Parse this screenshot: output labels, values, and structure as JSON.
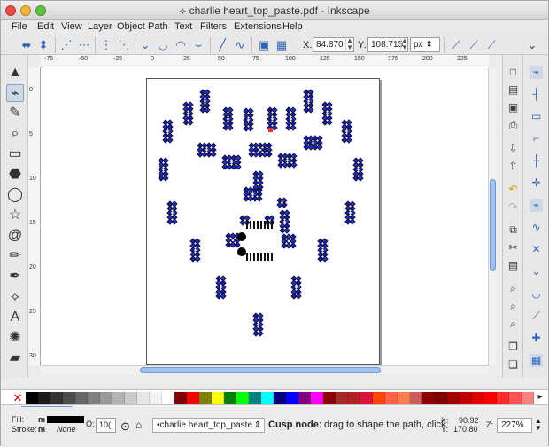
{
  "window": {
    "title": "charlie heart_top_paste.pdf - Inkscape",
    "buttons": [
      "close",
      "minimize",
      "zoom"
    ]
  },
  "menus": [
    "File",
    "Edit",
    "View",
    "Layer",
    "Object",
    "Path",
    "Text",
    "Filters",
    "Extensions",
    "Help"
  ],
  "toolbar": {
    "x_label": "X:",
    "x_value": "84.870",
    "y_label": "Y:",
    "y_value": "108.715",
    "unit": "px",
    "icons": [
      "insert-node-icon",
      "delete-node-icon",
      "join-nodes-icon",
      "break-path-icon",
      "join-segment-icon",
      "delete-segment-icon",
      "cusp-node-icon",
      "smooth-node-icon",
      "symmetric-node-icon",
      "auto-node-icon",
      "line-segment-icon",
      "curve-segment-icon",
      "object-to-path-icon",
      "stroke-to-path-icon",
      "next-path-effect-icon",
      "show-handles-icon",
      "show-outline-icon"
    ]
  },
  "rulers": {
    "top": [
      "-75",
      "-50",
      "-25",
      "0",
      "25",
      "50",
      "75",
      "100",
      "125",
      "150",
      "175",
      "200",
      "225"
    ],
    "left": [
      "0",
      "5",
      "10",
      "15",
      "20",
      "25",
      "30"
    ]
  },
  "tools": [
    {
      "name": "selector-tool-icon",
      "glyph": "▲"
    },
    {
      "name": "node-tool-icon",
      "glyph": "⌁"
    },
    {
      "name": "tweak-tool-icon",
      "glyph": "✎"
    },
    {
      "name": "zoom-tool-icon",
      "glyph": "🔍"
    },
    {
      "name": "rectangle-tool-icon",
      "glyph": "▭"
    },
    {
      "name": "box-tool-icon",
      "glyph": "⬣"
    },
    {
      "name": "ellipse-tool-icon",
      "glyph": "◯"
    },
    {
      "name": "star-tool-icon",
      "glyph": "☆"
    },
    {
      "name": "spiral-tool-icon",
      "glyph": "@"
    },
    {
      "name": "pencil-tool-icon",
      "glyph": "✏"
    },
    {
      "name": "pen-tool-icon",
      "glyph": "✒"
    },
    {
      "name": "calligraphy-tool-icon",
      "glyph": "𝓟"
    },
    {
      "name": "text-tool-icon",
      "glyph": "A"
    },
    {
      "name": "spray-tool-icon",
      "glyph": "✺"
    },
    {
      "name": "eraser-tool-icon",
      "glyph": "▰"
    }
  ],
  "palette": [
    "#000000",
    "#1a1a1a",
    "#333333",
    "#4d4d4d",
    "#666666",
    "#808080",
    "#999999",
    "#b3b3b3",
    "#cccccc",
    "#e6e6e6",
    "#f2f2f2",
    "#ffffff",
    "#800000",
    "#ff0000",
    "#808000",
    "#ffff00",
    "#008000",
    "#00ff00",
    "#008080",
    "#00ffff",
    "#000080",
    "#0000ff",
    "#800080",
    "#ff00ff",
    "#8b0000",
    "#a52a2a",
    "#b22222",
    "#dc143c",
    "#ff4500",
    "#ff6347",
    "#ff7f50",
    "#cd5c5c",
    "#8b0000",
    "#7f0000",
    "#a00000",
    "#c00000",
    "#e00000",
    "#ff0000",
    "#ff2a2a",
    "#ff5555",
    "#ff8080"
  ],
  "status": {
    "fill_label": "Fill:",
    "fill_value": "m",
    "stroke_label": "Stroke:",
    "stroke_value": "m",
    "stroke_style": "None",
    "opacity_label": "O:",
    "opacity_value": "10(",
    "layer": "•charlie heart_top_paste",
    "message_bold": "Cusp node",
    "message_rest": ": drag to shape the path, click",
    "coord_x_label": "X:",
    "coord_x": "90.92",
    "coord_y_label": "Y:",
    "coord_y": "170.80",
    "zoom_label": "Z:",
    "zoom": "227%"
  }
}
